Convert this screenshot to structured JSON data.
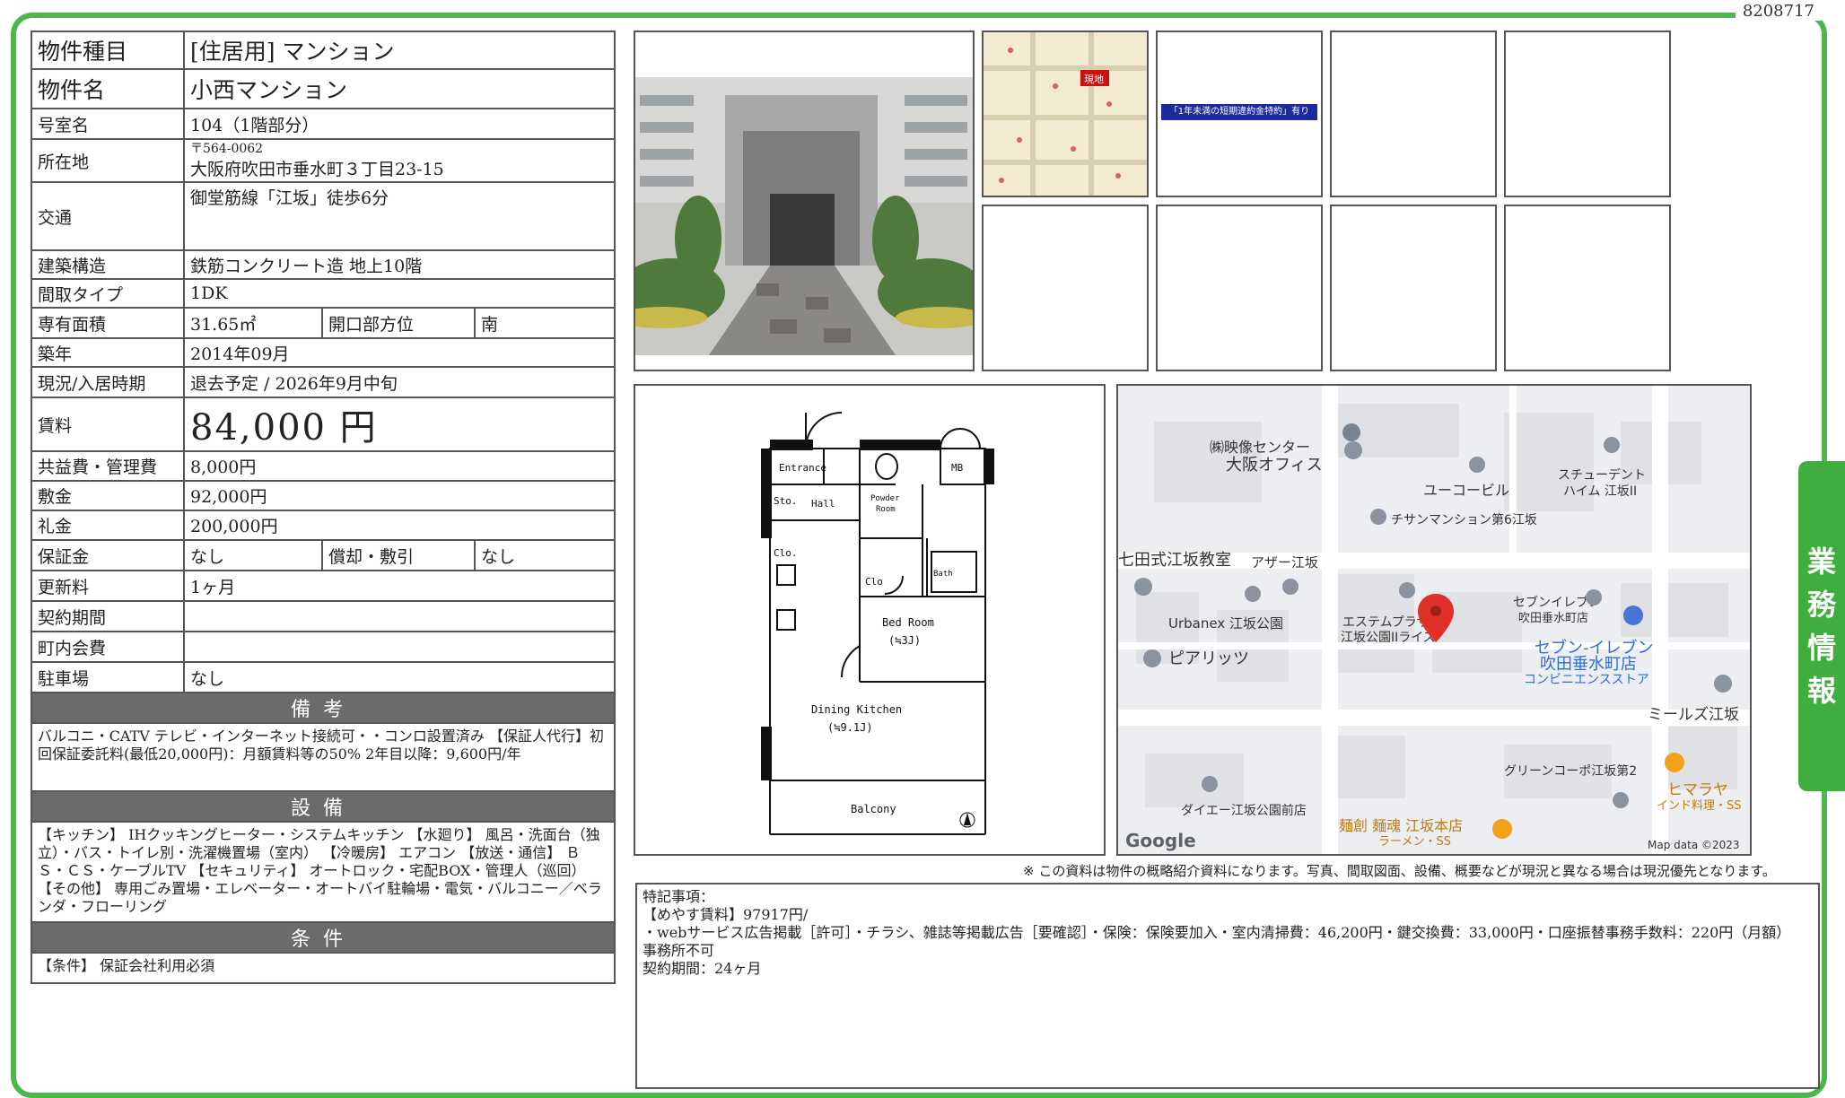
{
  "doc_id": "8208717",
  "side_tab": [
    "業",
    "務",
    "情",
    "報"
  ],
  "property": {
    "type_label": "物件種目",
    "type_value": "[住居用] マンション",
    "name_label": "物件名",
    "name_value": "小西マンション",
    "room_label": "号室名",
    "room_value": "104（1階部分）",
    "address_label": "所在地",
    "postal": "〒564-0062",
    "address": "大阪府吹田市垂水町３丁目23-15",
    "access_label": "交通",
    "access_value": "御堂筋線「江坂」徒歩6分",
    "structure_label": "建築構造",
    "structure_value": "鉄筋コンクリート造 地上10階",
    "layout_label": "間取タイプ",
    "layout_value": "1DK",
    "area_label": "専有面積",
    "area_value": "31.65㎡",
    "facing_label": "開口部方位",
    "facing_value": "南",
    "built_label": "築年",
    "built_value": "2014年09月",
    "status_label": "現況/入居時期",
    "status_value": "退去予定 / 2026年9月中旬",
    "rent_label": "賃料",
    "rent_value": "84,000 円",
    "fee_label": "共益費・管理費",
    "fee_value": "8,000円",
    "deposit_label": "敷金",
    "deposit_value": "92,000円",
    "keymoney_label": "礼金",
    "keymoney_value": "200,000円",
    "guarantee_label": "保証金",
    "guarantee_value": "なし",
    "amort_label": "償却・敷引",
    "amort_value": "なし",
    "renewal_label": "更新料",
    "renewal_value": "1ヶ月",
    "contract_label": "契約期間",
    "contract_value": "",
    "town_label": "町内会費",
    "town_value": "",
    "parking_label": "駐車場",
    "parking_value": "なし"
  },
  "remarks": {
    "title": "備考",
    "text": "バルコニ・CATV テレビ・インターネット接続可・・コンロ設置済み 【保証人代行】初回保証委託料(最低20,000円)：月額賃料等の50% 2年目以降：9,600円/年"
  },
  "equipment": {
    "title": "設備",
    "text": "【キッチン】 IHクッキングヒーター・システムキッチン 【水廻り】 風呂・洗面台（独立）・バス・トイレ別・洗濯機置場（室内） 【冷暖房】 エアコン 【放送・通信】 ＢＳ・ＣＳ・ケーブルTV 【セキュリティ】 オートロック・宅配BOX・管理人（巡回） 【その他】 専用ごみ置場・エレベーター・オートバイ駐輪場・電気・バルコニー／ベランダ・フローリング"
  },
  "conditions": {
    "title": "条件",
    "text": "【条件】 保証会社利用必須"
  },
  "thumb_banner": "「1年未満の短期違約金特約」有り",
  "thumb_map_label": "現地",
  "floorplan": {
    "entrance": "Entrance",
    "mb": "MB",
    "sto": "Sto.",
    "hall": "Hall",
    "powder": "Powder",
    "room": "Room",
    "clo1": "Clo.",
    "clo2": "Clo",
    "bath": "Bath",
    "bedroom": "Bed Room",
    "bed_size": "(≒3J)",
    "dining": "Dining Kitchen",
    "dining_size": "(≒9.1J)",
    "balcony": "Balcony"
  },
  "map": {
    "labels": [
      "㈱映像センター",
      "大阪オフィス",
      "ユーコービル",
      "スチューデント",
      "ハイム 江坂II",
      "チサンマンション第6江坂",
      "七田式江坂教室",
      "アザー江坂",
      "Urbanex 江坂公園",
      "エステムプラザ",
      "江坂公園IIライズ",
      "セブンイレブン",
      "吹田垂水町店",
      "セブン-イレブン",
      "吹田垂水町店",
      "コンビニエンスストア",
      "ピアリッツ",
      "ミールズ江坂",
      "グリーンコーポ江坂第2",
      "ヒマラヤ",
      "インド料理・SS",
      "ダイエー江坂公園前店",
      "麺創 麺魂 江坂本店",
      "ラーメン・SS"
    ],
    "google": "Google",
    "copyright": "Map data ©2023"
  },
  "notice": "※ この資料は物件の概略紹介資料になります。写真、間取図面、設備、概要などが現況と異なる場合は現況優先となります。",
  "tokki": {
    "title": "特記事項：",
    "lines": [
      "【めやす賃料】97917円/",
      "・webサービス広告掲載［許可］・チラシ、雑誌等掲載広告［要確認］・保険：保険要加入・室内清掃費：46,200円・鍵交換費：33,000円・口座振替事務手数料：220円（月額）",
      "事務所不可",
      "契約期間：24ヶ月"
    ]
  },
  "colors": {
    "frame": "#4cb84c",
    "tab": "#3fae3f",
    "section": "#6b6b6b",
    "pin": "#e0302a"
  }
}
